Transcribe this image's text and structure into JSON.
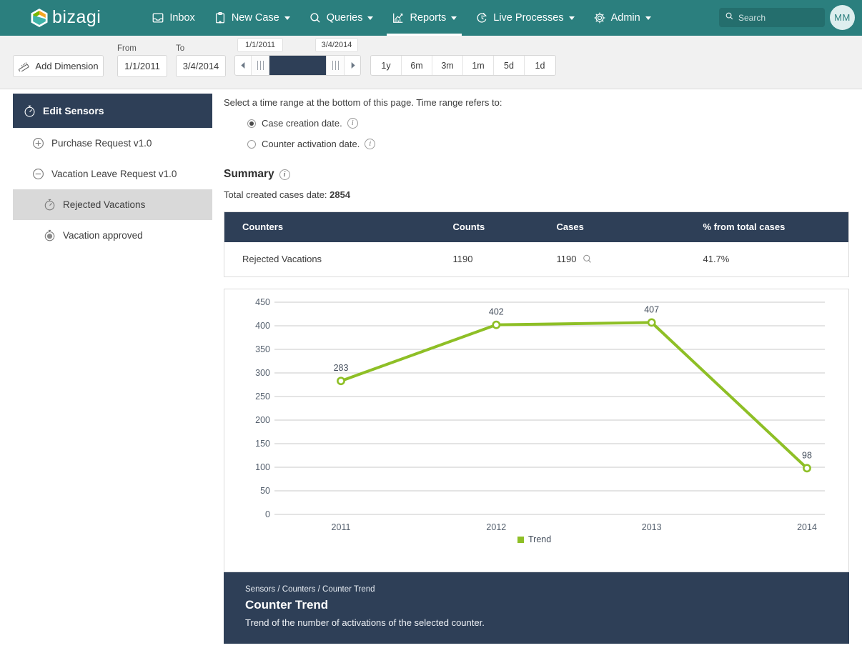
{
  "topnav": {
    "brand": "bizagi",
    "items": [
      {
        "label": "Inbox",
        "icon": "inbox-icon",
        "caret": false,
        "active": false
      },
      {
        "label": "New Case",
        "icon": "new-case-icon",
        "caret": true,
        "active": false
      },
      {
        "label": "Queries",
        "icon": "search-icon",
        "caret": true,
        "active": false
      },
      {
        "label": "Reports",
        "icon": "chart-icon",
        "caret": true,
        "active": true
      },
      {
        "label": "Live Processes",
        "icon": "live-processes-icon",
        "caret": true,
        "active": false
      },
      {
        "label": "Admin",
        "icon": "gear-icon",
        "caret": true,
        "active": false
      }
    ],
    "search_placeholder": "Search",
    "search_value": "",
    "avatar_initials": "MM"
  },
  "toolbar": {
    "add_dimension_label": "Add Dimension",
    "from_label": "From",
    "to_label": "To",
    "from_value": "1/1/2011",
    "to_value": "3/4/2014",
    "range_start_bubble": "1/1/2011",
    "range_end_bubble": "3/4/2014",
    "quick_ranges": [
      "1y",
      "6m",
      "3m",
      "1m",
      "5d",
      "1d"
    ]
  },
  "sidebar": {
    "header": "Edit Sensors",
    "header_icon": "stopwatch-icon",
    "items": [
      {
        "label": "Purchase Request v1.0",
        "icon": "plus-circle-icon",
        "level": 1,
        "selected": false
      },
      {
        "label": "Vacation Leave Request v1.0",
        "icon": "minus-circle-icon",
        "level": 1,
        "selected": false
      },
      {
        "label": "Rejected Vacations",
        "icon": "stopwatch-icon",
        "level": 2,
        "selected": true
      },
      {
        "label": "Vacation approved",
        "icon": "counter-icon",
        "level": 2,
        "selected": false
      }
    ]
  },
  "main": {
    "hint": "Select a time range at the bottom of this page. Time range refers to:",
    "radios": [
      {
        "label": "Case creation date.",
        "selected": true
      },
      {
        "label": "Counter activation date.",
        "selected": false
      }
    ],
    "summary_title": "Summary",
    "total_label": "Total created cases date:",
    "total_value": "2854",
    "table": {
      "headers": [
        "Counters",
        "Counts",
        "Cases",
        "% from total cases"
      ],
      "rows": [
        {
          "counter": "Rejected Vacations",
          "counts": "1190",
          "cases": "1190",
          "percent": "41.7%"
        }
      ]
    }
  },
  "footer": {
    "breadcrumb": "Sensors / Counters / Counter Trend",
    "title": "Counter Trend",
    "description": "Trend of the number of activations of the selected counter."
  },
  "chart_data": {
    "type": "line",
    "title": "",
    "xlabel": "",
    "ylabel": "",
    "categories": [
      "2011",
      "2012",
      "2013",
      "2014"
    ],
    "series": [
      {
        "name": "Trend",
        "values": [
          283,
          402,
          407,
          98
        ],
        "color": "#8ebf26"
      }
    ],
    "point_labels": [
      "283",
      "402",
      "407",
      "98"
    ],
    "ylim": [
      0,
      450
    ],
    "yticks": [
      0,
      50,
      100,
      150,
      200,
      250,
      300,
      350,
      400,
      450
    ],
    "ytick_labels": [
      "0",
      "50",
      "100",
      "150",
      "200",
      "250",
      "300",
      "350",
      "400",
      "450"
    ],
    "grid": true,
    "legend_position": "bottom",
    "legend": [
      "Trend"
    ]
  },
  "colors": {
    "brand_teal": "#2b7f7e",
    "navy": "#2e3f57",
    "accent_green": "#8ebf26",
    "toolbar_bg": "#f1f1f1"
  }
}
